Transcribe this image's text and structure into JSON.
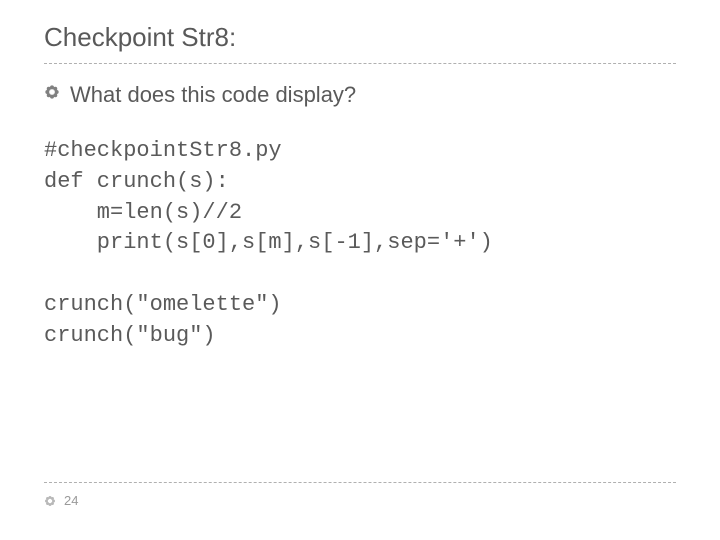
{
  "title": "Checkpoint Str8:",
  "question": "What does this code display?",
  "code_lines": [
    "#checkpointStr8.py",
    "def crunch(s):",
    "    m=len(s)//2",
    "    print(s[0],s[m],s[-1],sep='+')",
    "",
    "crunch(\"omelette\")",
    "crunch(\"bug\")"
  ],
  "page_number": "24"
}
